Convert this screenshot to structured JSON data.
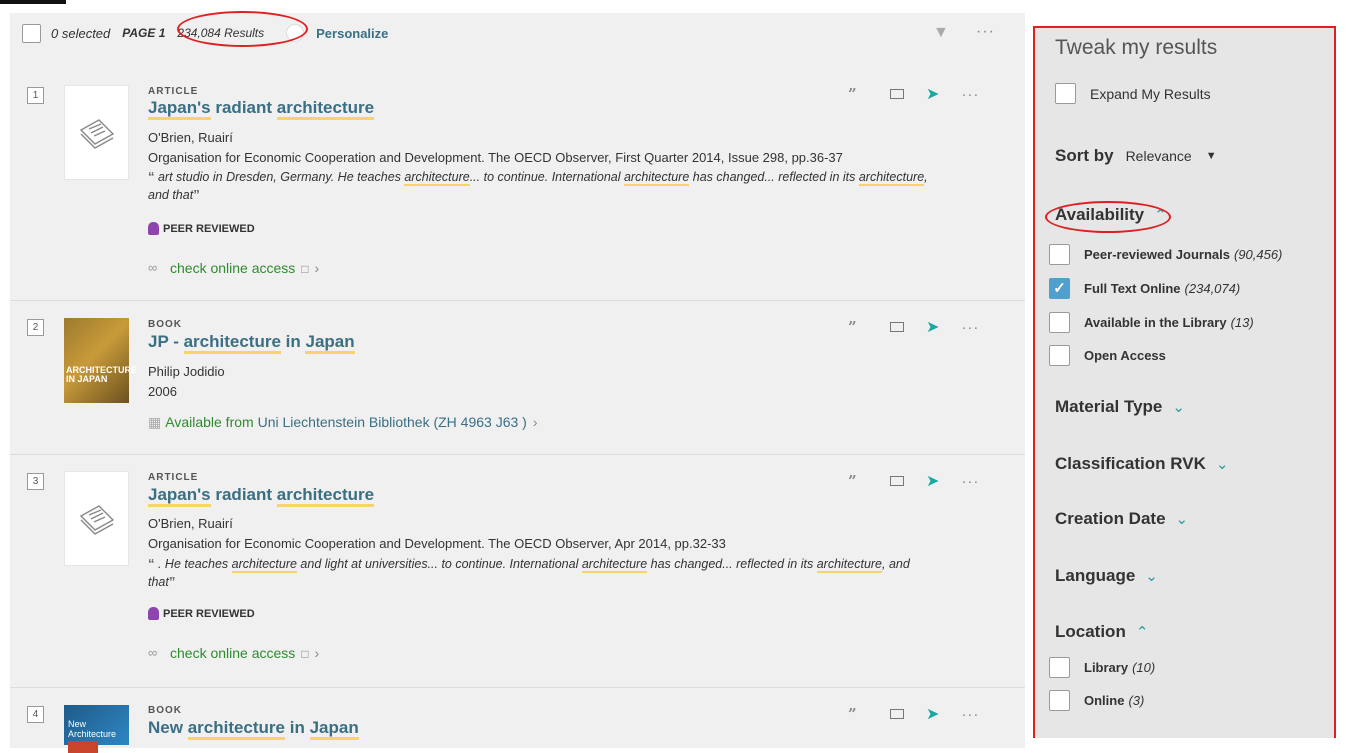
{
  "toolbar": {
    "selected": "0 selected",
    "page": "PAGE 1",
    "results": "234,084 Results",
    "personalize": "Personalize",
    "more": "···"
  },
  "results": [
    {
      "number": "1",
      "type": "ARTICLE",
      "title_parts": [
        "Japan's",
        " radiant ",
        "architecture"
      ],
      "author": "O'Brien, Ruairí",
      "source": "Organisation for Economic Cooperation and Development. The OECD Observer, First Quarter 2014, Issue 298, pp.36-37",
      "snippet": {
        "a": " art studio in Dresden, Germany. He teaches ",
        "b": "architecture",
        "c": "... to continue. International ",
        "d": "architecture",
        "e": " has changed... reflected in its ",
        "f": "architecture",
        "g": ", and that"
      },
      "peer": "PEER REVIEWED",
      "access": "check online access"
    },
    {
      "number": "2",
      "type": "BOOK",
      "title_parts": [
        "JP - ",
        "architecture",
        " in ",
        "Japan"
      ],
      "author": "Philip Jodidio",
      "year": "2006",
      "avail_prefix": "Available from ",
      "avail_lib": "Uni Liechtenstein",
      "avail_loc": "  Bibliothek (ZH 4963 J63 )",
      "cover_text": "ARCHITECTURE IN JAPAN"
    },
    {
      "number": "3",
      "type": "ARTICLE",
      "title_parts": [
        "Japan's",
        " radiant ",
        "architecture"
      ],
      "author": "O'Brien, Ruairí",
      "source": "Organisation for Economic Cooperation and Development. The OECD Observer, Apr 2014, pp.32-33",
      "snippet": {
        "a": " . He teaches ",
        "b": "architecture",
        "c": " and light at universities... to continue. International ",
        "d": "architecture",
        "e": " has changed... reflected in its ",
        "f": "architecture",
        "g": ", and that"
      },
      "peer": "PEER REVIEWED",
      "access": "check online access"
    },
    {
      "number": "4",
      "type": "BOOK",
      "title_parts": [
        "New ",
        "architecture",
        " in ",
        "Japan"
      ],
      "cover_text": "New Architecture"
    }
  ],
  "facets": {
    "title": "Tweak my results",
    "expand": "Expand My Results",
    "sort_label": "Sort by",
    "sort_value": "Relevance",
    "availability": {
      "heading": "Availability",
      "items": [
        {
          "label": "Peer-reviewed Journals",
          "count": "(90,456)",
          "checked": false
        },
        {
          "label": "Full Text Online",
          "count": "(234,074)",
          "checked": true
        },
        {
          "label": "Available in the Library",
          "count": "(13)",
          "checked": false
        },
        {
          "label": "Open Access",
          "count": "",
          "checked": false
        }
      ]
    },
    "material_type": "Material Type",
    "classification": "Classification RVK",
    "creation_date": "Creation Date",
    "language": "Language",
    "location": {
      "heading": "Location",
      "items": [
        {
          "label": "Library",
          "count": "(10)"
        },
        {
          "label": "Online",
          "count": "(3)"
        }
      ]
    }
  },
  "colors": {
    "accent": "#3a6f84",
    "highlight": "#f5d56a",
    "annotation": "#e02020",
    "available": "#2e8b2e"
  }
}
